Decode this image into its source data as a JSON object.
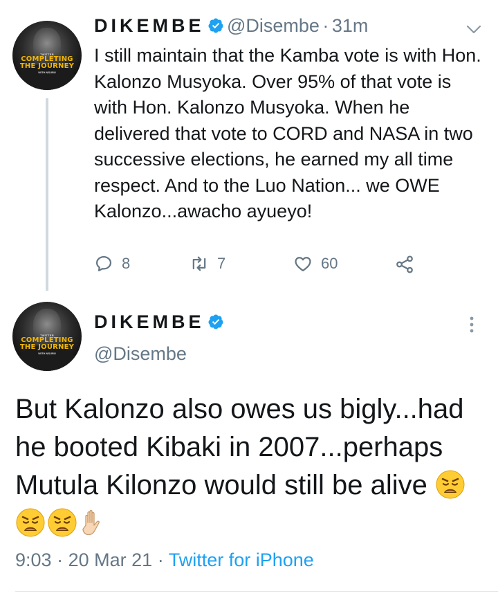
{
  "reply_tweet": {
    "display_name": "DIKEMBE",
    "handle": "@Disembe",
    "separator": "·",
    "time_ago": "31m",
    "text": "I still maintain that the Kamba vote is with Hon. Kalonzo Musyoka. Over 95% of that vote is with Hon. Kalonzo Musyoka. When he delivered that vote to CORD and NASA in two successive elections, he earned my all time respect. And to the Luo Nation... we OWE Kalonzo...awacho ayueyo!",
    "reply_count": "8",
    "retweet_count": "7",
    "like_count": "60"
  },
  "main_tweet": {
    "display_name": "DIKEMBE",
    "handle": "@Disembe",
    "text": "But Kalonzo also owes us bigly...had he booted Kibaki in 2007...perhaps Mutula Kilonzo would still be alive",
    "emojis": [
      "weary-face",
      "weary-face",
      "weary-face",
      "raised-hand"
    ],
    "time": "9:03",
    "separator1": "·",
    "date": "20 Mar 21",
    "separator2": "·",
    "source": "Twitter for iPhone"
  },
  "avatar": {
    "series": "TWITTER",
    "brand_line1": "COMPLETING",
    "brand_line2": "THE JOURNEY",
    "tagline": "WITH NSURU"
  },
  "icons": {
    "verified": "verified-badge-icon",
    "caret": "chevron-down-icon",
    "more": "more-vertical-icon",
    "reply": "reply-icon",
    "retweet": "retweet-icon",
    "like": "heart-icon",
    "share": "share-icon"
  },
  "colors": {
    "verified": "#1da1f2",
    "secondary_text": "#657786",
    "link": "#1da1f2",
    "brand": "#f2b600"
  }
}
